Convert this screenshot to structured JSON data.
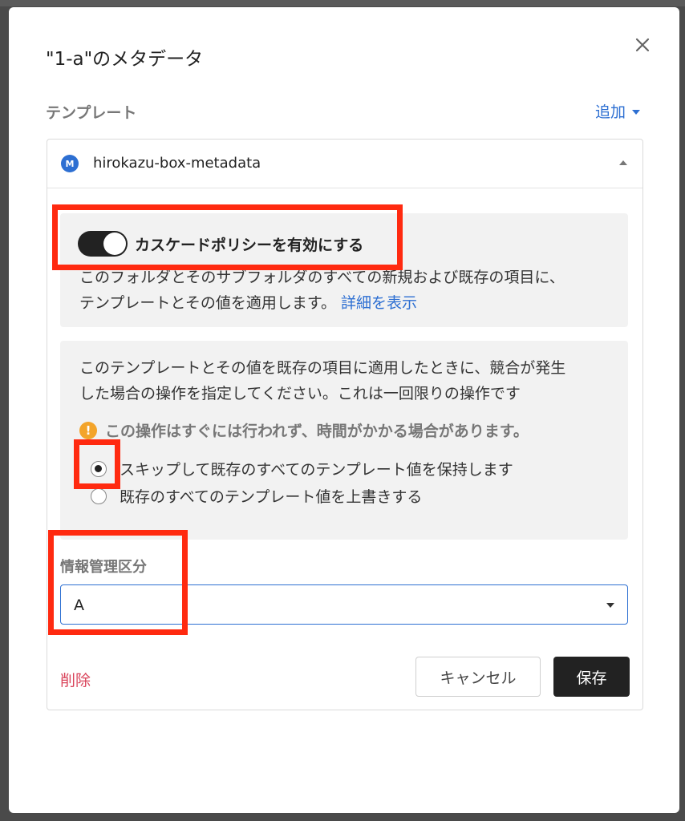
{
  "dialog": {
    "title": "\"1-a\"のメタデータ",
    "section_label": "テンプレート",
    "add_label": "追加"
  },
  "template": {
    "icon_letter": "M",
    "name": "hirokazu-box-metadata"
  },
  "cascade": {
    "toggle_on": true,
    "toggle_label": "カスケードポリシーを有効にする",
    "description_line1": "このフォルダとそのサブフォルダのすべての新規および既存の項目に、",
    "description_line2": "テンプレートとその値を適用します。",
    "details_link": "詳細を表示"
  },
  "conflict": {
    "description_line1": "このテンプレートとその値を既存の項目に適用したときに、競合が発生",
    "description_line2": "した場合の操作を指定してください。これは一回限りの操作です",
    "warning": "この操作はすぐには行われず、時間がかかる場合があります。",
    "options": [
      {
        "label": "スキップして既存のすべてのテンプレート値を保持します",
        "checked": true
      },
      {
        "label": "既存のすべてのテンプレート値を上書きする",
        "checked": false
      }
    ]
  },
  "field": {
    "label": "情報管理区分",
    "value": "A"
  },
  "footer": {
    "delete_label": "削除",
    "cancel_label": "キャンセル",
    "save_label": "保存"
  },
  "colors": {
    "accent": "#2d6fd2",
    "danger": "#d9435a",
    "highlight": "#ff2a10",
    "warning": "#f3a42a"
  }
}
